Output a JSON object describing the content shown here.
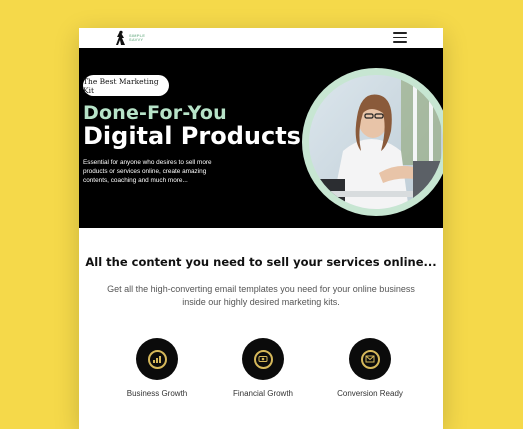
{
  "page": {
    "background": "#f5d94a"
  },
  "topbar": {
    "logo_text": [
      "SIMPLE",
      "SAVVY"
    ],
    "menu_icon": "hamburger-icon"
  },
  "hero": {
    "badge": "The Best Marketing Kit",
    "subtitle": "Done-For-You",
    "title": "Digital Products",
    "description": "Essential for anyone who desires to sell more products or services online, create amazing contents, coaching and much more...",
    "accent_color": "#b7e3c8"
  },
  "section": {
    "title": "All the content you need to sell your services online...",
    "description": "Get all the high-converting email templates you need for your online business inside our highly desired marketing kits."
  },
  "features": [
    {
      "label": "Business Growth",
      "icon": "business-growth-icon"
    },
    {
      "label": "Financial Growth",
      "icon": "financial-growth-icon"
    },
    {
      "label": "Conversion Ready",
      "icon": "conversion-ready-icon"
    }
  ]
}
